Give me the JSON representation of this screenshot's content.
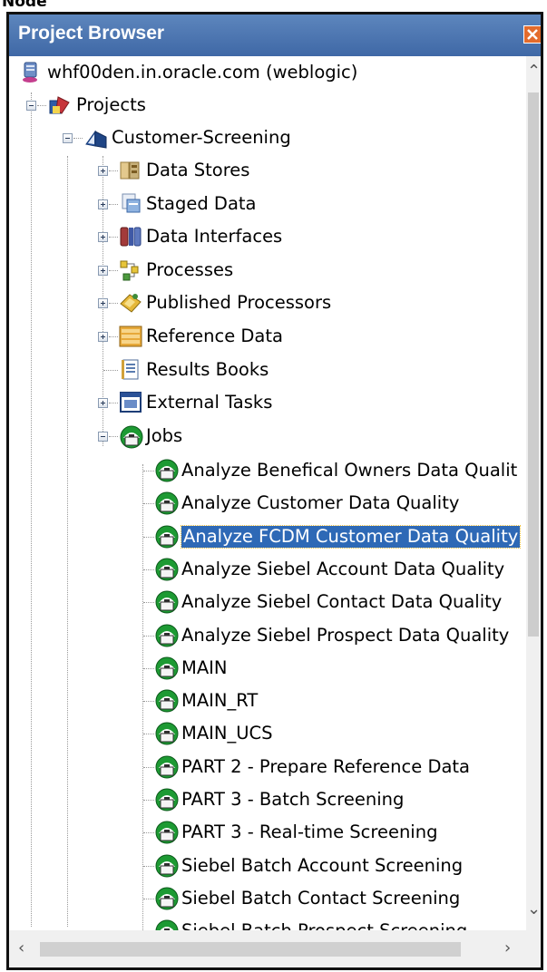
{
  "caption": "Node",
  "window": {
    "title": "Project Browser"
  },
  "tree": {
    "server": "whf00den.in.oracle.com (weblogic)",
    "projects": "Projects",
    "project": "Customer-Screening",
    "folders": [
      {
        "label": "Data Stores",
        "icon": "database-icon",
        "expandable": true
      },
      {
        "label": "Staged Data",
        "icon": "staged-data-icon",
        "expandable": true
      },
      {
        "label": "Data Interfaces",
        "icon": "data-interface-icon",
        "expandable": true
      },
      {
        "label": "Processes",
        "icon": "process-icon",
        "expandable": true
      },
      {
        "label": "Published Processors",
        "icon": "published-processor-icon",
        "expandable": true
      },
      {
        "label": "Reference Data",
        "icon": "reference-data-icon",
        "expandable": true
      },
      {
        "label": "Results Books",
        "icon": "results-book-icon",
        "expandable": false
      },
      {
        "label": "External Tasks",
        "icon": "external-task-icon",
        "expandable": true
      },
      {
        "label": "Jobs",
        "icon": "job-icon",
        "expandable": true,
        "expanded": true
      }
    ],
    "jobs": [
      "Analyze Benefical Owners Data Qualit",
      "Analyze Customer Data Quality",
      "Analyze FCDM Customer Data Quality",
      "Analyze Siebel Account Data Quality",
      "Analyze Siebel Contact Data Quality",
      "Analyze Siebel Prospect Data Quality",
      "MAIN",
      "MAIN_RT",
      "MAIN_UCS",
      "PART 2 - Prepare Reference Data",
      "PART 3 - Batch Screening",
      "PART 3 - Real-time Screening",
      "Siebel Batch Account Screening",
      "Siebel Batch Contact Screening",
      "Siebel Batch Prospect Screening"
    ],
    "selected_job": "Analyze FCDM Customer Data Quality"
  },
  "colors": {
    "title_bar": "#4a73ae",
    "selection": "#2e69b6",
    "close_button": "#e36b2c"
  }
}
